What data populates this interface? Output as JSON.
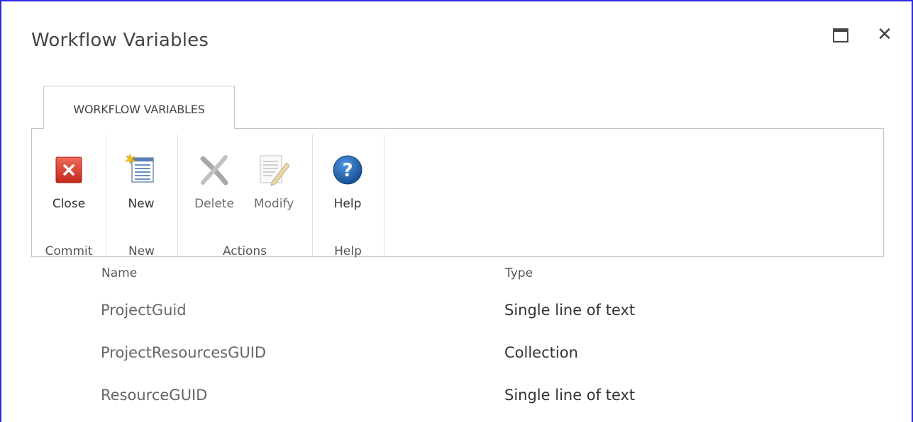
{
  "dialog": {
    "title": "Workflow Variables"
  },
  "ribbon": {
    "tab_label": "WORKFLOW VARIABLES",
    "groups": [
      {
        "label": "Commit",
        "buttons": [
          {
            "label": "Close",
            "icon": "close-red-x-icon",
            "enabled": true
          }
        ]
      },
      {
        "label": "New",
        "buttons": [
          {
            "label": "New",
            "icon": "new-list-icon",
            "enabled": true
          }
        ]
      },
      {
        "label": "Actions",
        "buttons": [
          {
            "label": "Delete",
            "icon": "delete-x-icon",
            "enabled": false
          },
          {
            "label": "Modify",
            "icon": "modify-pencil-icon",
            "enabled": false
          }
        ]
      },
      {
        "label": "Help",
        "buttons": [
          {
            "label": "Help",
            "icon": "help-question-icon",
            "enabled": true
          }
        ]
      }
    ]
  },
  "table": {
    "headers": {
      "name": "Name",
      "type": "Type"
    },
    "rows": [
      {
        "name": "ProjectGuid",
        "type": "Single line of text"
      },
      {
        "name": "ProjectResourcesGUID",
        "type": "Collection"
      },
      {
        "name": "ResourceGUID",
        "type": "Single line of text"
      }
    ]
  },
  "colors": {
    "border_accent": "#2a2ae0",
    "close_red": "#d9362b",
    "help_blue": "#1d5fa8"
  }
}
